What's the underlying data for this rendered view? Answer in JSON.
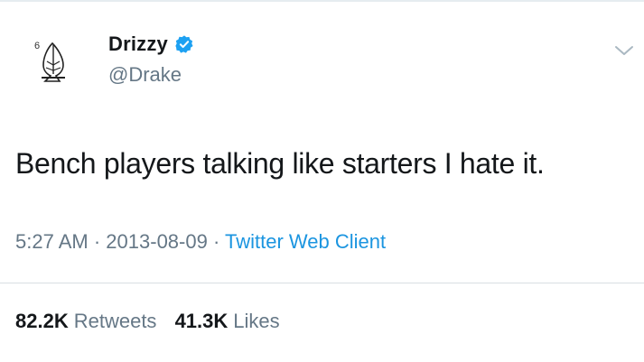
{
  "author": {
    "display_name": "Drizzy",
    "handle": "@Drake",
    "verified": true,
    "avatar_icon": "praying-hands-6-logo"
  },
  "tweet": {
    "text": "Bench players talking like starters I hate it.",
    "time": "5:27 AM",
    "separator": "·",
    "date": "2013-08-09",
    "client": "Twitter Web Client"
  },
  "stats": {
    "retweets_count": "82.2K",
    "retweets_label": "Retweets",
    "likes_count": "41.3K",
    "likes_label": "Likes"
  },
  "colors": {
    "verified_blue": "#1da1f2",
    "link_blue": "#1b95e0",
    "muted_gray": "#657786"
  }
}
